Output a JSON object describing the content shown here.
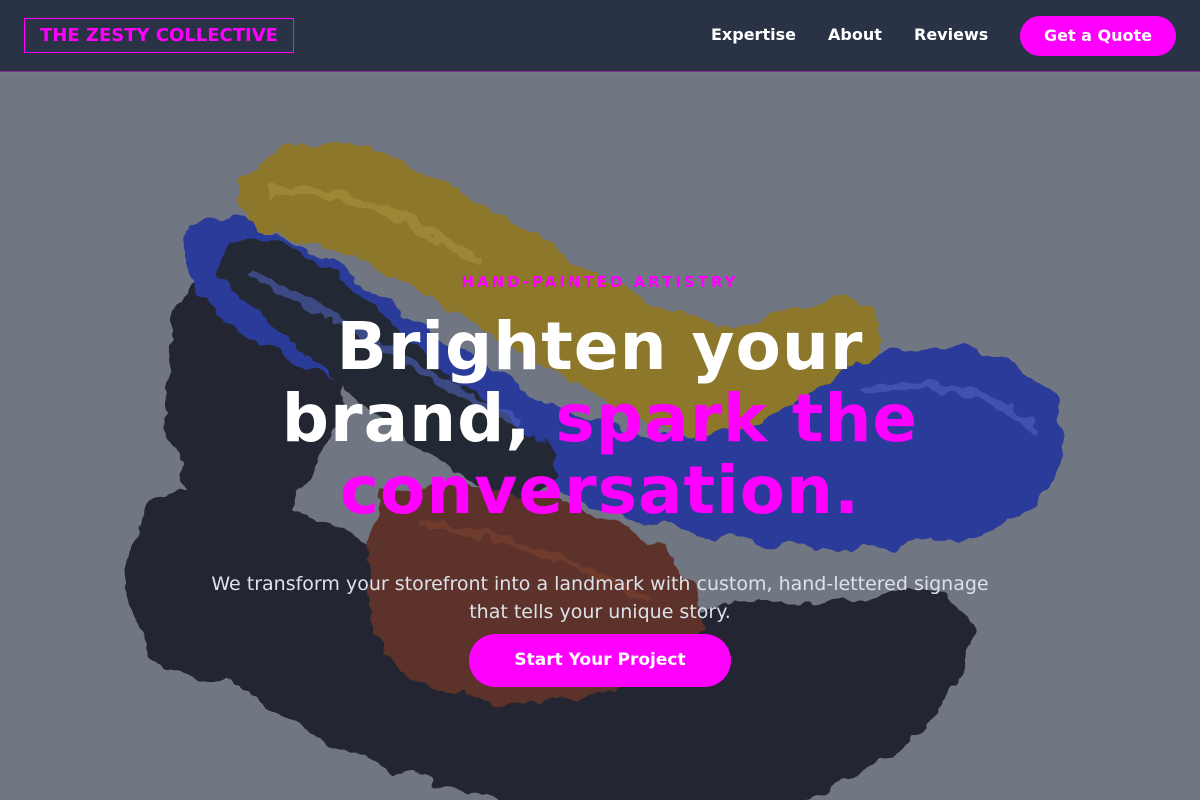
{
  "nav": {
    "brand": "THE ZESTY COLLECTIVE",
    "links": [
      {
        "label": "Expertise"
      },
      {
        "label": "About"
      },
      {
        "label": "Reviews"
      }
    ],
    "cta_label": "Get a Quote"
  },
  "hero": {
    "eyebrow": "HAND-PAINTED ARTISTRY",
    "headline": {
      "line1": "Brighten your",
      "line2_white": "brand, ",
      "line2_accent": "spark the",
      "line3_accent": "conversation."
    },
    "subtitle": {
      "line1": "We transform your storefront into a landmark with custom, hand-lettered signage",
      "line2": "that tells your unique story."
    },
    "cta_label": "Start Your Project",
    "background": {
      "subject": "abstract paint brush strokes",
      "colors": [
        "#c9a31b",
        "#2f46c4",
        "#1f2330",
        "#7a3416"
      ]
    }
  },
  "colors": {
    "accent": "#ff00ff",
    "navbar_bg": "#293345",
    "hero_bg": "#787b87",
    "text_light": "#ffffff"
  }
}
